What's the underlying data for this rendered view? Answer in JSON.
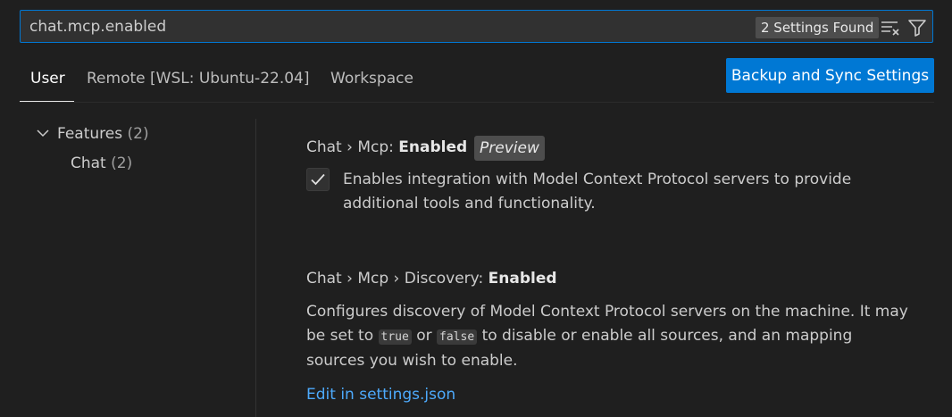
{
  "search": {
    "value": "chat.mcp.enabled",
    "results_badge": "2 Settings Found"
  },
  "tabs": [
    {
      "label": "User",
      "active": true
    },
    {
      "label": "Remote [WSL: Ubuntu-22.04]",
      "active": false
    },
    {
      "label": "Workspace",
      "active": false
    }
  ],
  "sync_button_label": "Backup and Sync Settings",
  "toc": {
    "group": {
      "label": "Features",
      "count": "(2)"
    },
    "child": {
      "label": "Chat",
      "count": "(2)"
    }
  },
  "settings": [
    {
      "category": "Chat › Mcp: ",
      "name": "Enabled",
      "tag": "Preview",
      "checked": true,
      "description_line1": "Enables integration with Model Context Protocol servers to provide",
      "description_line2": "additional tools and functionality."
    },
    {
      "category": "Chat › Mcp › Discovery: ",
      "name": "Enabled",
      "description_part1": "Configures discovery of Model Context Protocol servers on the machine. It may",
      "description_part2": "be set to ",
      "code_true": "true",
      "description_or": " or ",
      "code_false": "false",
      "description_part3": " to disable or enable all sources, and an mapping",
      "description_part4": "sources you wish to enable.",
      "link": "Edit in settings.json"
    }
  ],
  "colors": {
    "accent": "#0078d4",
    "link": "#4daafc",
    "background": "#1f1f1f"
  }
}
